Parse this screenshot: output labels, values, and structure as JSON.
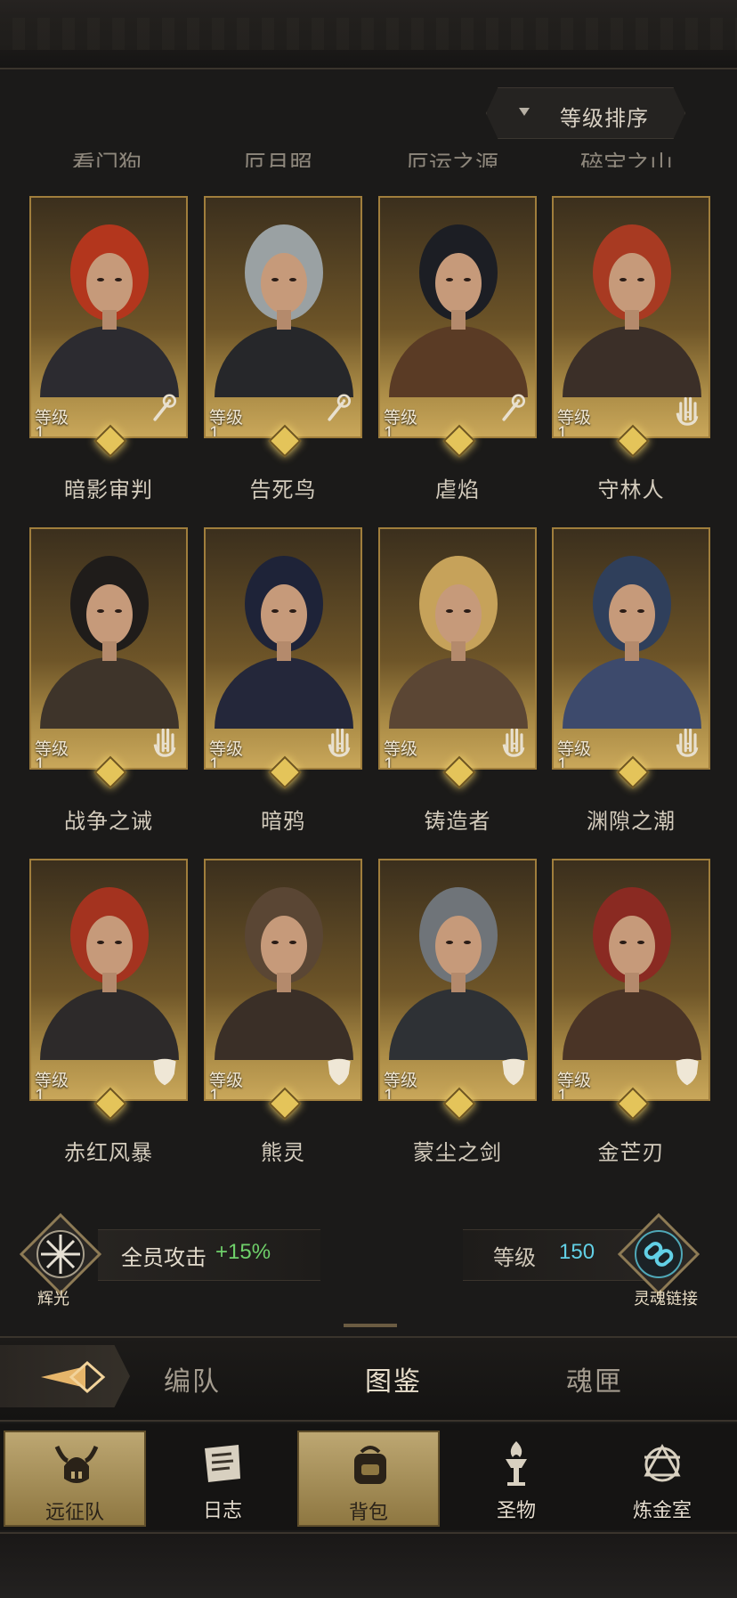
{
  "sort": {
    "label": "等级排序"
  },
  "cut_off_names": [
    "看门狗",
    "厄月照",
    "厄运之源",
    "碎宝之山"
  ],
  "level_label": "等级",
  "heroes": [
    {
      "name": "暗影审判",
      "level": "1",
      "class_icon": "staff-icon",
      "hair": "#b3361d",
      "tone": "#2c2b30"
    },
    {
      "name": "告死鸟",
      "level": "1",
      "class_icon": "staff-icon",
      "hair": "#9aa1a3",
      "tone": "#26272a"
    },
    {
      "name": "虐焰",
      "level": "1",
      "class_icon": "staff-icon",
      "hair": "#1c1e24",
      "tone": "#5a3b25"
    },
    {
      "name": "守林人",
      "level": "1",
      "class_icon": "palm-icon",
      "hair": "#a83a22",
      "tone": "#3b2f28"
    },
    {
      "name": "战争之诫",
      "level": "1",
      "class_icon": "palm-icon",
      "hair": "#1f1c1a",
      "tone": "#3e342a"
    },
    {
      "name": "暗鸦",
      "level": "1",
      "class_icon": "palm-icon",
      "hair": "#1e2338",
      "tone": "#24273a"
    },
    {
      "name": "铸造者",
      "level": "1",
      "class_icon": "palm-icon",
      "hair": "#c6a25a",
      "tone": "#5b4634"
    },
    {
      "name": "渊隙之潮",
      "level": "1",
      "class_icon": "palm-icon",
      "hair": "#2f3f5b",
      "tone": "#3d4a6c"
    },
    {
      "name": "赤红风暴",
      "level": "1",
      "class_icon": "shield-icon",
      "hair": "#a4331f",
      "tone": "#2d2a2a"
    },
    {
      "name": "熊灵",
      "level": "1",
      "class_icon": "shield-icon",
      "hair": "#5a4634",
      "tone": "#3a2f27"
    },
    {
      "name": "蒙尘之剑",
      "level": "1",
      "class_icon": "shield-icon",
      "hair": "#6f7479",
      "tone": "#2e3135"
    },
    {
      "name": "金芒刃",
      "level": "1",
      "class_icon": "shield-icon",
      "hair": "#8a2a22",
      "tone": "#4a3426"
    }
  ],
  "bonus": {
    "left_emblem_label": "辉光",
    "left_text": "全员攻击",
    "left_value": "+15%",
    "right_label": "等级",
    "right_value": "150",
    "right_emblem_label": "灵魂链接"
  },
  "tabs": [
    "编队",
    "图鉴",
    "魂匣"
  ],
  "active_tab": "图鉴",
  "nav": [
    {
      "label": "远征队",
      "icon": "viking-helmet-icon",
      "active": true
    },
    {
      "label": "日志",
      "icon": "scroll-icon",
      "active": false
    },
    {
      "label": "背包",
      "icon": "backpack-icon",
      "active": true
    },
    {
      "label": "圣物",
      "icon": "torch-icon",
      "active": false
    },
    {
      "label": "炼金室",
      "icon": "alchemy-icon",
      "active": false
    }
  ],
  "colors": {
    "accent_green": "#6fd06a",
    "accent_cyan": "#62d0e6",
    "card_gold": "#c9a75a"
  }
}
